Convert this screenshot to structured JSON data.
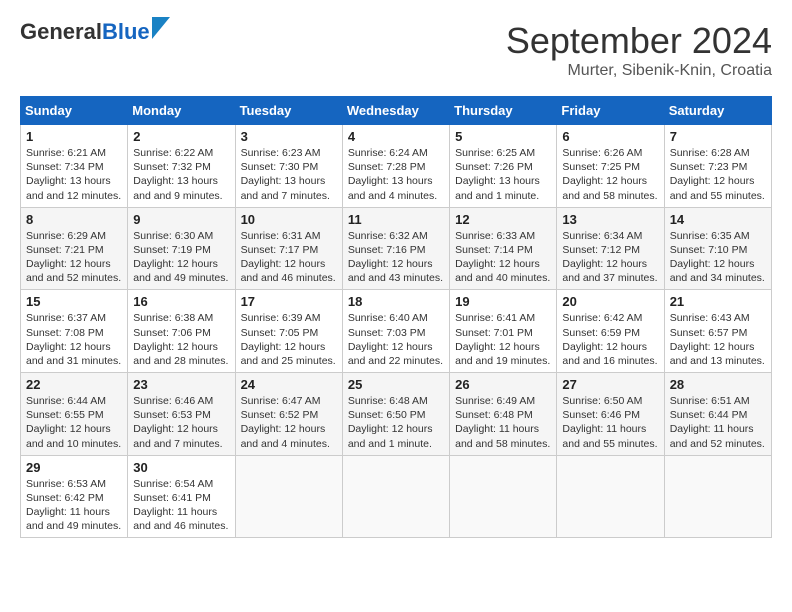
{
  "header": {
    "logo_general": "General",
    "logo_blue": "Blue",
    "month_title": "September 2024",
    "location": "Murter, Sibenik-Knin, Croatia"
  },
  "calendar": {
    "days_of_week": [
      "Sunday",
      "Monday",
      "Tuesday",
      "Wednesday",
      "Thursday",
      "Friday",
      "Saturday"
    ],
    "weeks": [
      [
        {
          "day": "1",
          "sunrise": "6:21 AM",
          "sunset": "7:34 PM",
          "daylight": "13 hours and 12 minutes."
        },
        {
          "day": "2",
          "sunrise": "6:22 AM",
          "sunset": "7:32 PM",
          "daylight": "13 hours and 9 minutes."
        },
        {
          "day": "3",
          "sunrise": "6:23 AM",
          "sunset": "7:30 PM",
          "daylight": "13 hours and 7 minutes."
        },
        {
          "day": "4",
          "sunrise": "6:24 AM",
          "sunset": "7:28 PM",
          "daylight": "13 hours and 4 minutes."
        },
        {
          "day": "5",
          "sunrise": "6:25 AM",
          "sunset": "7:26 PM",
          "daylight": "13 hours and 1 minute."
        },
        {
          "day": "6",
          "sunrise": "6:26 AM",
          "sunset": "7:25 PM",
          "daylight": "12 hours and 58 minutes."
        },
        {
          "day": "7",
          "sunrise": "6:28 AM",
          "sunset": "7:23 PM",
          "daylight": "12 hours and 55 minutes."
        }
      ],
      [
        {
          "day": "8",
          "sunrise": "6:29 AM",
          "sunset": "7:21 PM",
          "daylight": "12 hours and 52 minutes."
        },
        {
          "day": "9",
          "sunrise": "6:30 AM",
          "sunset": "7:19 PM",
          "daylight": "12 hours and 49 minutes."
        },
        {
          "day": "10",
          "sunrise": "6:31 AM",
          "sunset": "7:17 PM",
          "daylight": "12 hours and 46 minutes."
        },
        {
          "day": "11",
          "sunrise": "6:32 AM",
          "sunset": "7:16 PM",
          "daylight": "12 hours and 43 minutes."
        },
        {
          "day": "12",
          "sunrise": "6:33 AM",
          "sunset": "7:14 PM",
          "daylight": "12 hours and 40 minutes."
        },
        {
          "day": "13",
          "sunrise": "6:34 AM",
          "sunset": "7:12 PM",
          "daylight": "12 hours and 37 minutes."
        },
        {
          "day": "14",
          "sunrise": "6:35 AM",
          "sunset": "7:10 PM",
          "daylight": "12 hours and 34 minutes."
        }
      ],
      [
        {
          "day": "15",
          "sunrise": "6:37 AM",
          "sunset": "7:08 PM",
          "daylight": "12 hours and 31 minutes."
        },
        {
          "day": "16",
          "sunrise": "6:38 AM",
          "sunset": "7:06 PM",
          "daylight": "12 hours and 28 minutes."
        },
        {
          "day": "17",
          "sunrise": "6:39 AM",
          "sunset": "7:05 PM",
          "daylight": "12 hours and 25 minutes."
        },
        {
          "day": "18",
          "sunrise": "6:40 AM",
          "sunset": "7:03 PM",
          "daylight": "12 hours and 22 minutes."
        },
        {
          "day": "19",
          "sunrise": "6:41 AM",
          "sunset": "7:01 PM",
          "daylight": "12 hours and 19 minutes."
        },
        {
          "day": "20",
          "sunrise": "6:42 AM",
          "sunset": "6:59 PM",
          "daylight": "12 hours and 16 minutes."
        },
        {
          "day": "21",
          "sunrise": "6:43 AM",
          "sunset": "6:57 PM",
          "daylight": "12 hours and 13 minutes."
        }
      ],
      [
        {
          "day": "22",
          "sunrise": "6:44 AM",
          "sunset": "6:55 PM",
          "daylight": "12 hours and 10 minutes."
        },
        {
          "day": "23",
          "sunrise": "6:46 AM",
          "sunset": "6:53 PM",
          "daylight": "12 hours and 7 minutes."
        },
        {
          "day": "24",
          "sunrise": "6:47 AM",
          "sunset": "6:52 PM",
          "daylight": "12 hours and 4 minutes."
        },
        {
          "day": "25",
          "sunrise": "6:48 AM",
          "sunset": "6:50 PM",
          "daylight": "12 hours and 1 minute."
        },
        {
          "day": "26",
          "sunrise": "6:49 AM",
          "sunset": "6:48 PM",
          "daylight": "11 hours and 58 minutes."
        },
        {
          "day": "27",
          "sunrise": "6:50 AM",
          "sunset": "6:46 PM",
          "daylight": "11 hours and 55 minutes."
        },
        {
          "day": "28",
          "sunrise": "6:51 AM",
          "sunset": "6:44 PM",
          "daylight": "11 hours and 52 minutes."
        }
      ],
      [
        {
          "day": "29",
          "sunrise": "6:53 AM",
          "sunset": "6:42 PM",
          "daylight": "11 hours and 49 minutes."
        },
        {
          "day": "30",
          "sunrise": "6:54 AM",
          "sunset": "6:41 PM",
          "daylight": "11 hours and 46 minutes."
        },
        null,
        null,
        null,
        null,
        null
      ]
    ]
  }
}
